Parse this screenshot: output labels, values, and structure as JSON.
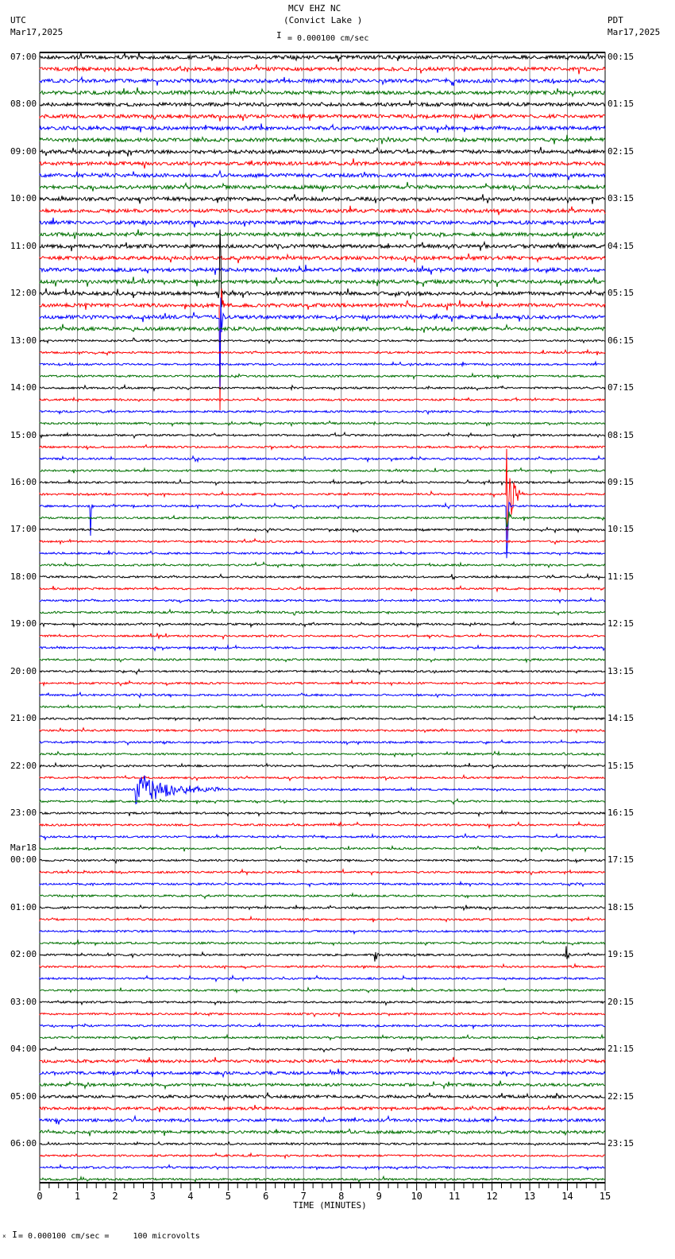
{
  "header": {
    "station": "MCV EHZ NC",
    "location": "(Convict Lake )",
    "left_tz": "UTC",
    "left_date": "Mar17,2025",
    "right_tz": "PDT",
    "right_date": "Mar17,2025",
    "scale_text": "= 0.000100 cm/sec"
  },
  "footer": {
    "scale_text": "= 0.000100 cm/sec =     100 microvolts"
  },
  "chart_data": {
    "type": "line",
    "title": "MCV EHZ NC (Convict Lake )",
    "xlabel": "TIME (MINUTES)",
    "xlim": [
      0,
      15
    ],
    "x_ticks": [
      "0",
      "1",
      "2",
      "3",
      "4",
      "5",
      "6",
      "7",
      "8",
      "9",
      "10",
      "11",
      "12",
      "13",
      "14",
      "15"
    ],
    "rows_per_hour": 4,
    "trace_colors": [
      "#000000",
      "#ff0000",
      "#0000ff",
      "#007000"
    ],
    "left_labels": [
      "07:00",
      "08:00",
      "09:00",
      "10:00",
      "11:00",
      "12:00",
      "13:00",
      "14:00",
      "15:00",
      "16:00",
      "17:00",
      "18:00",
      "19:00",
      "20:00",
      "21:00",
      "22:00",
      "23:00",
      "00:00",
      "01:00",
      "02:00",
      "03:00",
      "04:00",
      "05:00",
      "06:00"
    ],
    "left_date_change": {
      "label": "Mar18",
      "at_hour": "00:00"
    },
    "right_labels": [
      "00:15",
      "01:15",
      "02:15",
      "03:15",
      "04:15",
      "05:15",
      "06:15",
      "07:15",
      "08:15",
      "09:15",
      "10:15",
      "11:15",
      "12:15",
      "13:15",
      "14:15",
      "15:15",
      "16:15",
      "17:15",
      "18:15",
      "19:15",
      "20:15",
      "21:15",
      "22:15",
      "23:15"
    ]
  }
}
